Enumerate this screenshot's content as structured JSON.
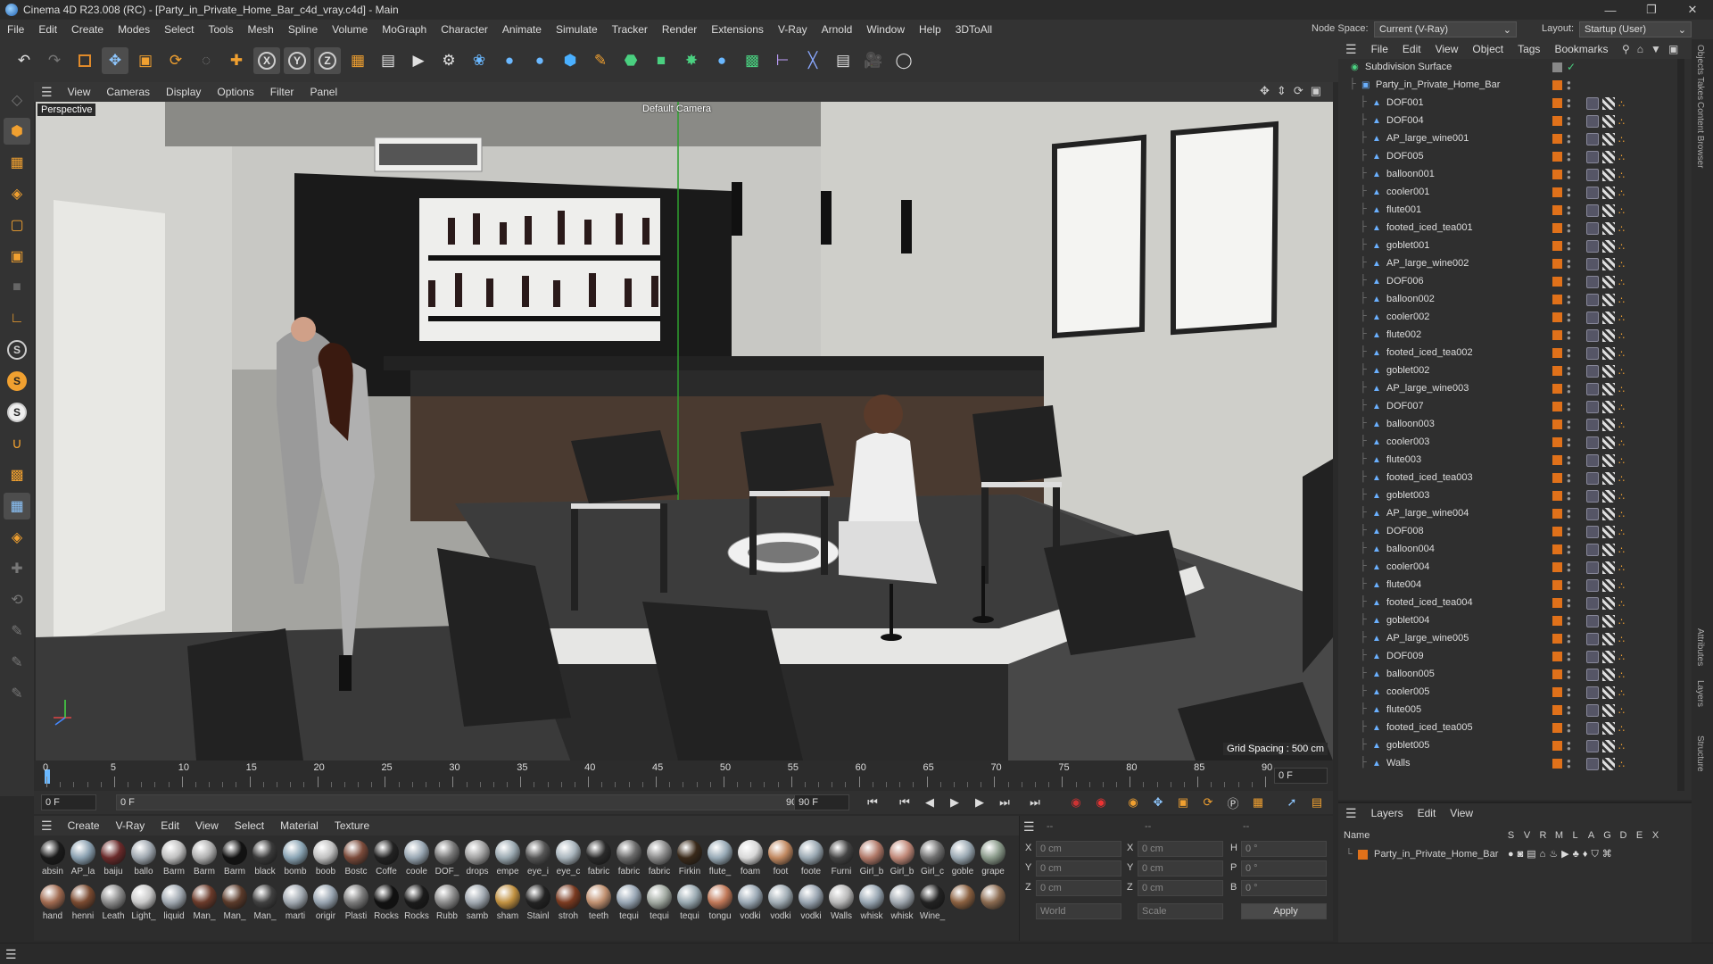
{
  "window": {
    "title": "Cinema 4D R23.008 (RC) - [Party_in_Private_Home_Bar_c4d_vray.c4d] - Main"
  },
  "menu": [
    "File",
    "Edit",
    "Create",
    "Modes",
    "Select",
    "Tools",
    "Mesh",
    "Spline",
    "Volume",
    "MoGraph",
    "Character",
    "Animate",
    "Simulate",
    "Tracker",
    "Render",
    "Extensions",
    "V-Ray",
    "Arnold",
    "Window",
    "Help",
    "3DToAll"
  ],
  "nodespace": {
    "label": "Node Space:",
    "value": "Current (V-Ray)"
  },
  "layout": {
    "label": "Layout:",
    "value": "Startup (User)"
  },
  "viewport_menu": [
    "View",
    "Cameras",
    "Display",
    "Options",
    "Filter",
    "Panel"
  ],
  "viewport": {
    "label": "Perspective",
    "camera": "Default Camera",
    "grid": "Grid Spacing : 500 cm"
  },
  "timeline": {
    "ticks": [
      "0",
      "5",
      "10",
      "15",
      "20",
      "25",
      "30",
      "35",
      "40",
      "45",
      "50",
      "55",
      "60",
      "65",
      "70",
      "75",
      "80",
      "85",
      "90"
    ],
    "frame_right": "0 F"
  },
  "playback": {
    "start": "0 F",
    "current": "0 F",
    "end": "90 F",
    "end2": "90 F"
  },
  "material_menu": [
    "Create",
    "V-Ray",
    "Edit",
    "View",
    "Select",
    "Material",
    "Texture"
  ],
  "materials": [
    {
      "n": "absin",
      "c": "#1a1a1a"
    },
    {
      "n": "AP_la",
      "c": "#8aa0b0"
    },
    {
      "n": "baiju",
      "c": "#6a2a2a"
    },
    {
      "n": "ballo",
      "c": "#a0a8b0"
    },
    {
      "n": "Barm",
      "c": "#c0c0c0"
    },
    {
      "n": "Barm",
      "c": "#b0b0b0"
    },
    {
      "n": "Barm",
      "c": "#121212"
    },
    {
      "n": "black",
      "c": "#3a3a3a"
    },
    {
      "n": "bomb",
      "c": "#8aa4b4"
    },
    {
      "n": "boob",
      "c": "#c0c0c0"
    },
    {
      "n": "Bostc",
      "c": "#7a4a3a"
    },
    {
      "n": "Coffe",
      "c": "#222"
    },
    {
      "n": "coole",
      "c": "#98a6b2"
    },
    {
      "n": "DOF_",
      "c": "#777"
    },
    {
      "n": "drops",
      "c": "#a0a0a0"
    },
    {
      "n": "empe",
      "c": "#9aa8b0"
    },
    {
      "n": "eye_i",
      "c": "#555"
    },
    {
      "n": "eye_c",
      "c": "#a8b4bc"
    },
    {
      "n": "fabric",
      "c": "#2a2a2a"
    },
    {
      "n": "fabric",
      "c": "#6a6a6a"
    },
    {
      "n": "fabric",
      "c": "#8a8a8a"
    },
    {
      "n": "Firkin",
      "c": "#3a2a1a"
    },
    {
      "n": "flute_",
      "c": "#98aab6"
    },
    {
      "n": "foam",
      "c": "#d8d8d8"
    },
    {
      "n": "foot",
      "c": "#c08860"
    },
    {
      "n": "foote",
      "c": "#9aa8b2"
    },
    {
      "n": "Furni",
      "c": "#444"
    },
    {
      "n": "Girl_b",
      "c": "#b07868"
    },
    {
      "n": "Girl_b",
      "c": "#c08878"
    },
    {
      "n": "Girl_c",
      "c": "#707070"
    },
    {
      "n": "goble",
      "c": "#9aa8b2"
    },
    {
      "n": "grape",
      "c": "#8a9a8a"
    },
    {
      "n": "hand",
      "c": "#a06a50"
    },
    {
      "n": "henni",
      "c": "#7a4a30"
    },
    {
      "n": "Leath",
      "c": "#8a8a8a"
    },
    {
      "n": "Light_",
      "c": "#c8c8c8"
    },
    {
      "n": "liquid",
      "c": "#a0a8b0"
    },
    {
      "n": "Man_",
      "c": "#6a3a2a"
    },
    {
      "n": "Man_",
      "c": "#5a3a2a"
    },
    {
      "n": "Man_",
      "c": "#404040"
    },
    {
      "n": "marti",
      "c": "#a0a8b0"
    },
    {
      "n": "origir",
      "c": "#98a4b0"
    },
    {
      "n": "Plasti",
      "c": "#7a7a7a"
    },
    {
      "n": "Rocks",
      "c": "#111"
    },
    {
      "n": "Rocks",
      "c": "#1a1a1a"
    },
    {
      "n": "Rubb",
      "c": "#8a8a8a"
    },
    {
      "n": "samb",
      "c": "#a0a8b0"
    },
    {
      "n": "sham",
      "c": "#c09040"
    },
    {
      "n": "Stainl",
      "c": "#222"
    },
    {
      "n": "stroh",
      "c": "#7a3a20"
    },
    {
      "n": "teeth",
      "c": "#c09070"
    },
    {
      "n": "tequi",
      "c": "#98a6b4"
    },
    {
      "n": "tequi",
      "c": "#a0a8a0"
    },
    {
      "n": "tequi",
      "c": "#98a8b0"
    },
    {
      "n": "tongu",
      "c": "#c07858"
    },
    {
      "n": "vodki",
      "c": "#9aa8b4"
    },
    {
      "n": "vodki",
      "c": "#a0acb4"
    },
    {
      "n": "vodki",
      "c": "#98a4b0"
    },
    {
      "n": "Walls",
      "c": "#b8b8b8"
    },
    {
      "n": "whisk",
      "c": "#98a6b2"
    },
    {
      "n": "whisk",
      "c": "#a0a8b0"
    },
    {
      "n": "Wine_",
      "c": "#222"
    },
    {
      "n": "",
      "c": "#8a6040"
    },
    {
      "n": "",
      "c": "#8a6a50"
    }
  ],
  "coords": {
    "x": "X",
    "y": "Y",
    "z": "Z",
    "h": "H",
    "p": "P",
    "b": "B",
    "pos_x": "0 cm",
    "pos_y": "0 cm",
    "pos_z": "0 cm",
    "size_x": "0 cm",
    "size_y": "0 cm",
    "size_z": "0 cm",
    "rot_h": "0 °",
    "rot_p": "0 °",
    "rot_b": "0 °",
    "dash": "--",
    "world": "World",
    "scale": "Scale",
    "apply": "Apply"
  },
  "objects_menu": [
    "File",
    "Edit",
    "View",
    "Object",
    "Tags",
    "Bookmarks"
  ],
  "objects": [
    {
      "name": "Subdivision Surface",
      "lvl": 0
    },
    {
      "name": "Party_in_Private_Home_Bar",
      "lvl": 1
    },
    {
      "name": "DOF001",
      "lvl": 2
    },
    {
      "name": "DOF004",
      "lvl": 2
    },
    {
      "name": "AP_large_wine001",
      "lvl": 2
    },
    {
      "name": "DOF005",
      "lvl": 2
    },
    {
      "name": "balloon001",
      "lvl": 2
    },
    {
      "name": "cooler001",
      "lvl": 2
    },
    {
      "name": "flute001",
      "lvl": 2
    },
    {
      "name": "footed_iced_tea001",
      "lvl": 2
    },
    {
      "name": "goblet001",
      "lvl": 2
    },
    {
      "name": "AP_large_wine002",
      "lvl": 2
    },
    {
      "name": "DOF006",
      "lvl": 2
    },
    {
      "name": "balloon002",
      "lvl": 2
    },
    {
      "name": "cooler002",
      "lvl": 2
    },
    {
      "name": "flute002",
      "lvl": 2
    },
    {
      "name": "footed_iced_tea002",
      "lvl": 2
    },
    {
      "name": "goblet002",
      "lvl": 2
    },
    {
      "name": "AP_large_wine003",
      "lvl": 2
    },
    {
      "name": "DOF007",
      "lvl": 2
    },
    {
      "name": "balloon003",
      "lvl": 2
    },
    {
      "name": "cooler003",
      "lvl": 2
    },
    {
      "name": "flute003",
      "lvl": 2
    },
    {
      "name": "footed_iced_tea003",
      "lvl": 2
    },
    {
      "name": "goblet003",
      "lvl": 2
    },
    {
      "name": "AP_large_wine004",
      "lvl": 2
    },
    {
      "name": "DOF008",
      "lvl": 2
    },
    {
      "name": "balloon004",
      "lvl": 2
    },
    {
      "name": "cooler004",
      "lvl": 2
    },
    {
      "name": "flute004",
      "lvl": 2
    },
    {
      "name": "footed_iced_tea004",
      "lvl": 2
    },
    {
      "name": "goblet004",
      "lvl": 2
    },
    {
      "name": "AP_large_wine005",
      "lvl": 2
    },
    {
      "name": "DOF009",
      "lvl": 2
    },
    {
      "name": "balloon005",
      "lvl": 2
    },
    {
      "name": "cooler005",
      "lvl": 2
    },
    {
      "name": "flute005",
      "lvl": 2
    },
    {
      "name": "footed_iced_tea005",
      "lvl": 2
    },
    {
      "name": "goblet005",
      "lvl": 2
    },
    {
      "name": "Walls",
      "lvl": 2
    }
  ],
  "layers_menu": [
    "Layers",
    "Edit",
    "View"
  ],
  "layers": {
    "name_header": "Name",
    "flags": [
      "S",
      "V",
      "R",
      "M",
      "L",
      "A",
      "G",
      "D",
      "E",
      "X"
    ],
    "item": "Party_in_Private_Home_Bar"
  },
  "side_tabs": [
    "Objects",
    "Takes",
    "Content Browser",
    "Attributes",
    "Layers",
    "Structure"
  ],
  "colors": {
    "accent": "#e0711a",
    "panel": "#2f2f2f",
    "toolbar": "#333333"
  }
}
